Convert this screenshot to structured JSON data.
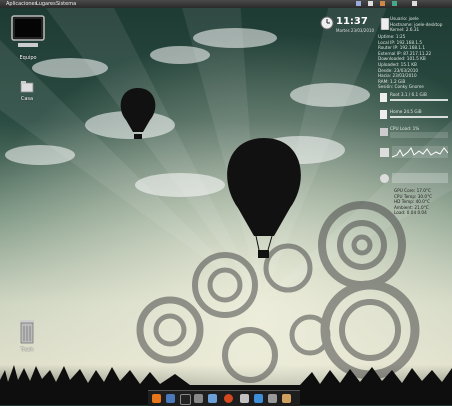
{
  "top_panel": {
    "menus": [
      "Aplicaciones",
      "Lugares",
      "Sistema"
    ]
  },
  "desktop_icons": [
    {
      "label": "Equipo",
      "icon": "computer-icon"
    },
    {
      "label": "Casa",
      "icon": "home-folder-icon"
    },
    {
      "label": "Trash",
      "icon": "trash-icon"
    }
  ],
  "clock": {
    "time": "11:37",
    "date": "Martes 23/03/2010"
  },
  "conky": {
    "sysinfo": [
      "Usuario: joele",
      "Hostname: joele-desktop",
      "Kernel: 2.6.31",
      "Uptime: 1:25",
      "Local IP: 192.168.1.5",
      "Router IP: 192.168.1.1",
      "External IP: 87.217.11.22",
      "Downloaded: 101.5 KB",
      "Uploaded: 15.1 KB",
      "Desde: 23/03/2010",
      "Hacia: 23/03/2010",
      "RAM: 1.2 GiB",
      "Sesión: Conky Gnome"
    ],
    "gauges": [
      {
        "label": "Root 3.1 / 6.1 GiB",
        "icon": "disk-icon"
      },
      {
        "label": "Home 24.5 GiB",
        "icon": "home-disk-icon"
      },
      {
        "label": "CPU Load: 1%",
        "icon": "cpu-icon"
      },
      {
        "label": "",
        "icon": "ram-icon"
      },
      {
        "label": "",
        "icon": "network-icon"
      }
    ],
    "weather": [
      "GPU Core: 17.0°C",
      "CPU Temp: 30.0°C",
      "HD Temp: 40.0°C",
      "Ambient: 21.0°C",
      "Load: 0.04 0.04"
    ]
  },
  "dock_icons": [
    "firefox-icon",
    "files-icon",
    "terminal-icon",
    "settings-icon",
    "music-icon",
    "ubuntu-icon",
    "mail-icon",
    "chat-icon",
    "home-icon",
    "web-icon"
  ]
}
